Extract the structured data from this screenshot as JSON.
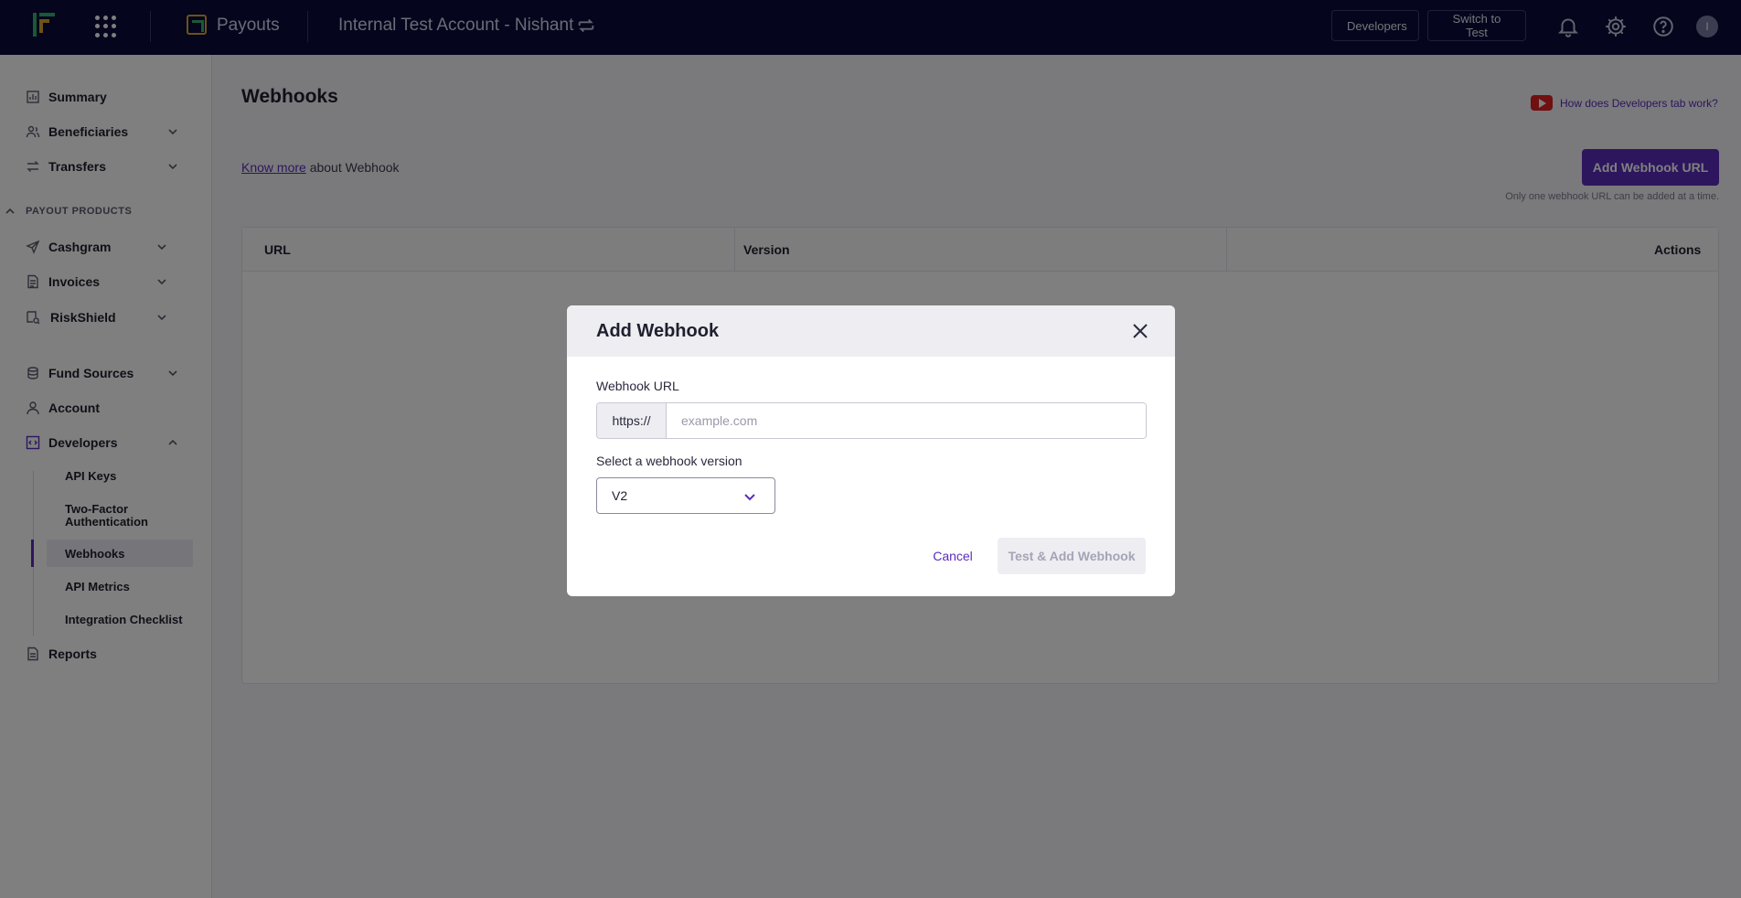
{
  "topbar": {
    "product_name": "Payouts",
    "account_name": "Internal Test Account - Nishant",
    "developers_label": "Developers",
    "switch_label": "Switch to Test",
    "avatar_initial": "I"
  },
  "sidebar": {
    "summary": "Summary",
    "beneficiaries": "Beneficiaries",
    "transfers": "Transfers",
    "section_payout_products": "PAYOUT PRODUCTS",
    "cashgram": "Cashgram",
    "invoices": "Invoices",
    "riskshield": "RiskShield",
    "fund_sources": "Fund Sources",
    "account": "Account",
    "developers": "Developers",
    "developers_sub": [
      "API Keys",
      "Two-Factor Authentication",
      "Webhooks",
      "API Metrics",
      "Integration Checklist"
    ],
    "reports": "Reports"
  },
  "main": {
    "title": "Webhooks",
    "help_link": "How does Developers tab work?",
    "know_more_link": "Know more",
    "know_more_text": "about Webhook",
    "add_button": "Add Webhook URL",
    "note": "Only one webhook URL can be added at a time.",
    "table_headers": [
      "URL",
      "Version",
      "Actions"
    ]
  },
  "modal": {
    "title": "Add Webhook",
    "url_label": "Webhook URL",
    "url_prefix": "https://",
    "url_placeholder": "example.com",
    "url_value": "",
    "version_label": "Select a webhook version",
    "version_value": "V2",
    "cancel_label": "Cancel",
    "submit_label": "Test & Add Webhook"
  },
  "colors": {
    "topbar_bg": "#0a0a3a",
    "accent": "#5b2dbd",
    "overlay": "rgba(0,0,0,0.5)"
  }
}
